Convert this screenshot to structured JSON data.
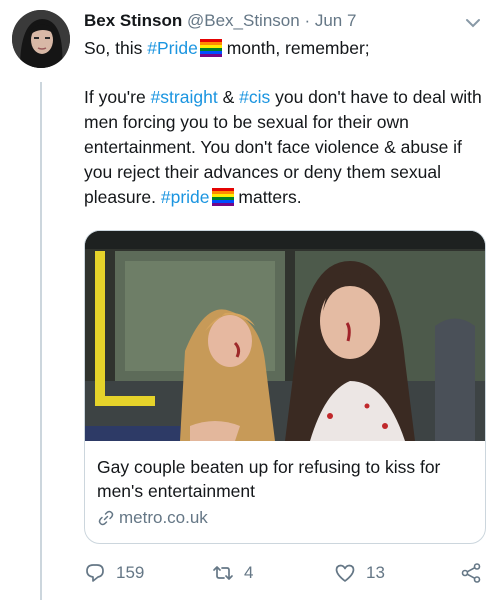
{
  "tweet": {
    "author_name": "Bex Stinson",
    "author_handle": "@Bex_Stinson",
    "separator": "·",
    "date": "Jun 7",
    "line1_before": "So, this ",
    "hashtag1": "#Pride",
    "line1_after": " month, remember;",
    "p2_before": "If you're ",
    "hashtag2": "#straight",
    "p2_amp": " & ",
    "hashtag3": "#cis",
    "p2_middle": " you don't have to deal with men forcing you to be sexual for their own entertainment. You don't face violence & abuse if you reject their advances or deny them sexual pleasure. ",
    "hashtag4": "#pride",
    "p2_end": " matters."
  },
  "card": {
    "title": "Gay couple beaten up for refusing to kiss for men's entertainment",
    "domain": "metro.co.uk"
  },
  "actions": {
    "replies": "159",
    "retweets": "4",
    "likes": "13"
  },
  "colors": {
    "link": "#1b95e0",
    "muted": "#657786",
    "border": "#ccd6dd"
  },
  "icons": [
    "chevron-down-icon",
    "rainbow-flag-icon",
    "link-icon",
    "reply-icon",
    "retweet-icon",
    "like-icon",
    "share-icon"
  ]
}
